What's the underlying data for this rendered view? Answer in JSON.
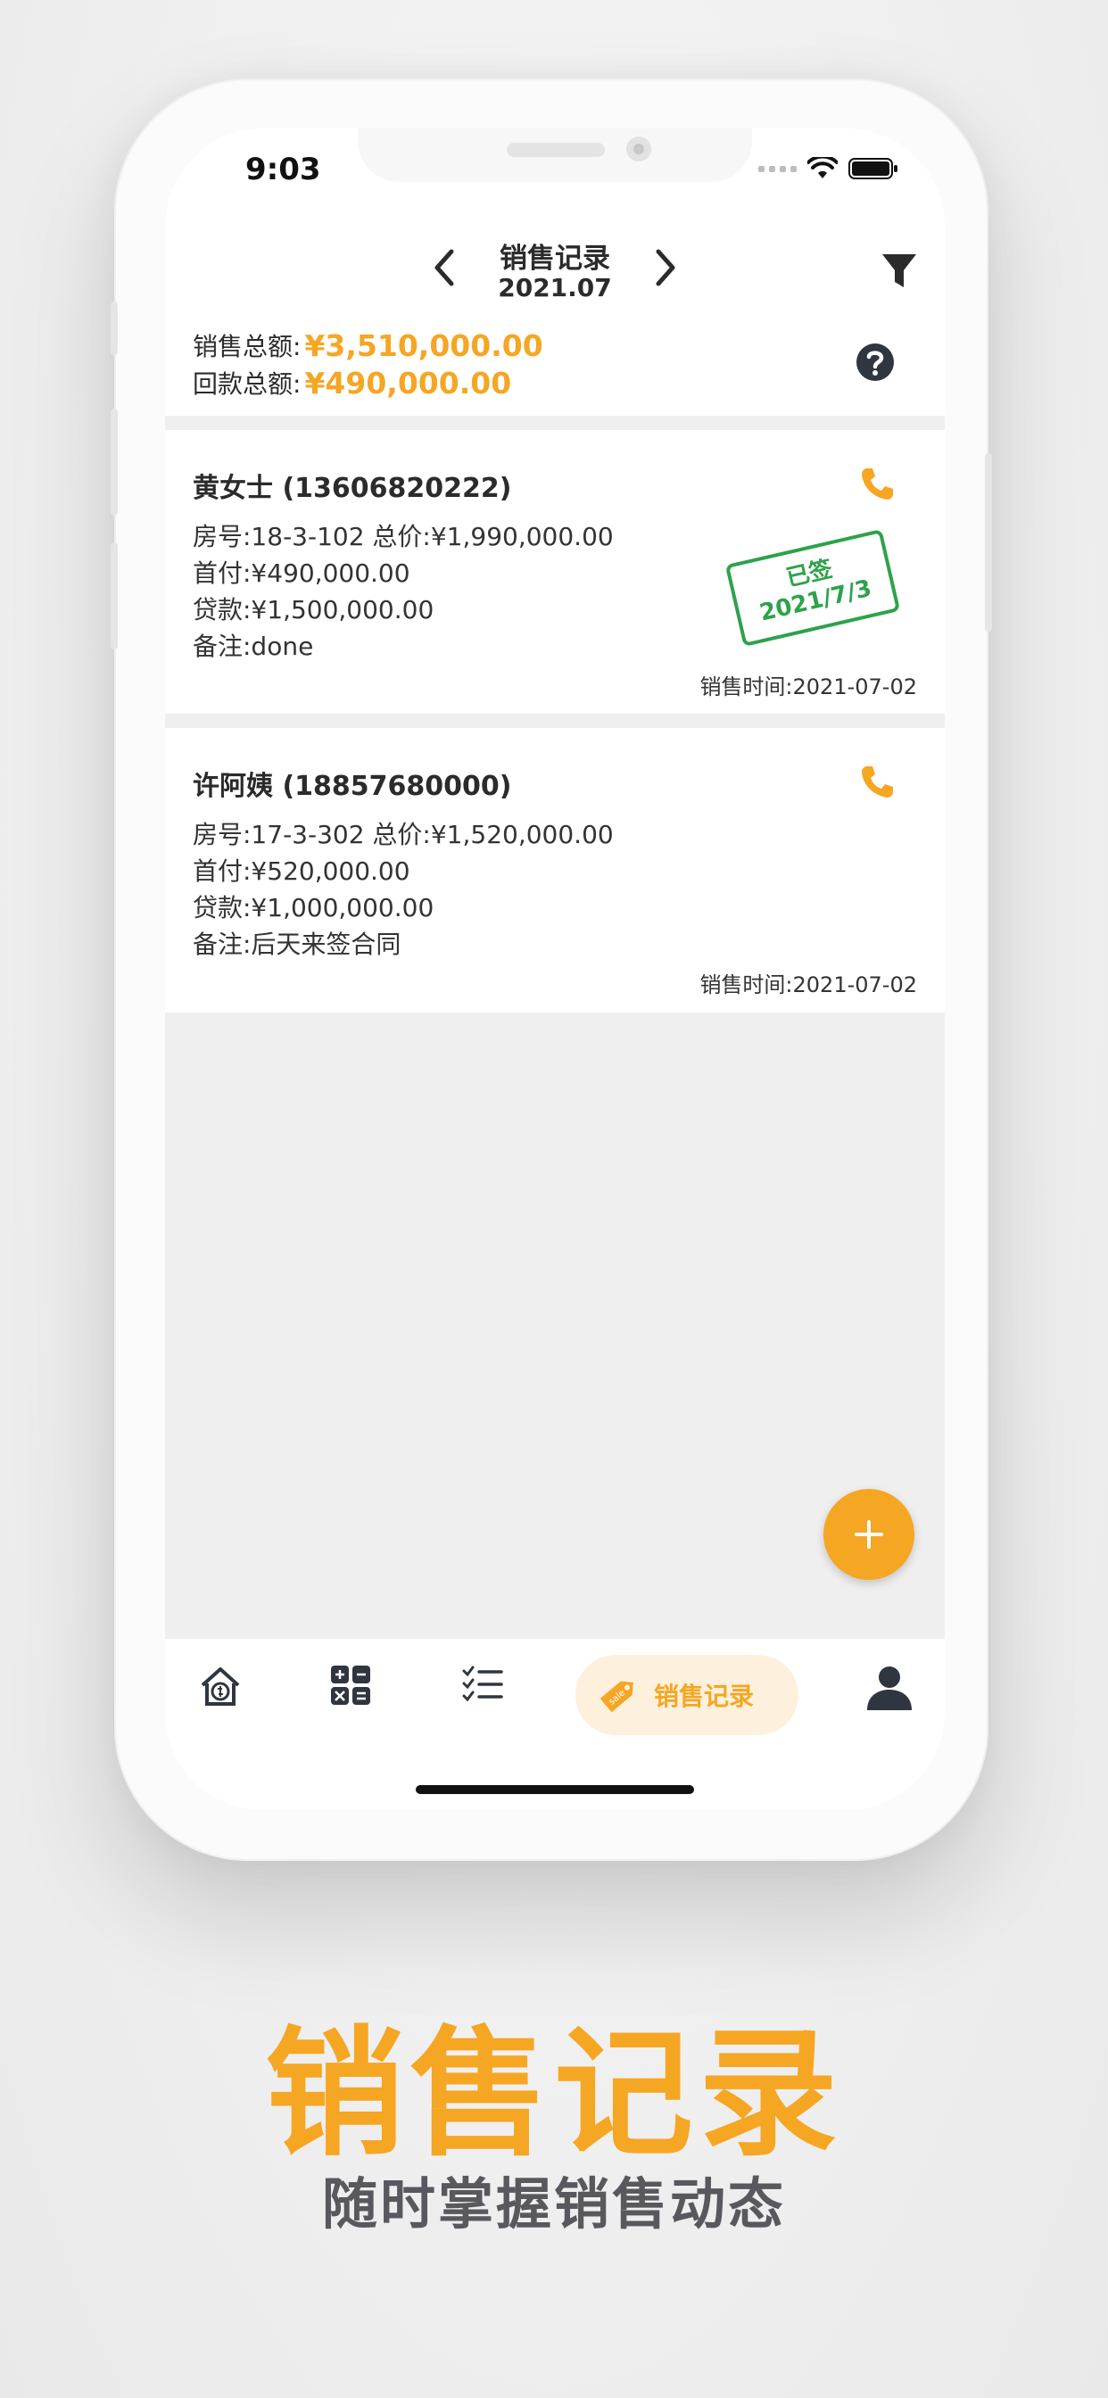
{
  "status_bar": {
    "time": "9:03"
  },
  "header": {
    "title": "销售记录",
    "period": "2021.07"
  },
  "summary": {
    "sales_label": "销售总额:",
    "sales_value": "¥3,510,000.00",
    "refund_label": "回款总额:",
    "refund_value": "¥490,000.00"
  },
  "records": [
    {
      "name": "黄女士 (13606820222)",
      "line1": "房号:18-3-102 总价:¥1,990,000.00",
      "line2": "首付:¥490,000.00",
      "line3": "贷款:¥1,500,000.00",
      "line4": "备注:done",
      "time": "销售时间:2021-07-02",
      "stamp_status": "已签",
      "stamp_date": "2021/7/3"
    },
    {
      "name": "许阿姨 (18857680000)",
      "line1": "房号:17-3-302 总价:¥1,520,000.00",
      "line2": "首付:¥520,000.00",
      "line3": "贷款:¥1,000,000.00",
      "line4": "备注:后天来签合同",
      "time": "销售时间:2021-07-02"
    }
  ],
  "tabbar": {
    "active_label": "销售记录",
    "active_badge": "sale",
    "tabs": [
      "home-price-icon",
      "calculator-icon",
      "checklist-icon",
      "sales-tag-icon",
      "profile-icon"
    ]
  },
  "caption": {
    "title": "销售记录",
    "subtitle": "随时掌握销售动态"
  },
  "colors": {
    "accent": "#f5a623",
    "stamp": "#2ea24a",
    "text": "#2b2b2b",
    "background": "#efefef"
  }
}
